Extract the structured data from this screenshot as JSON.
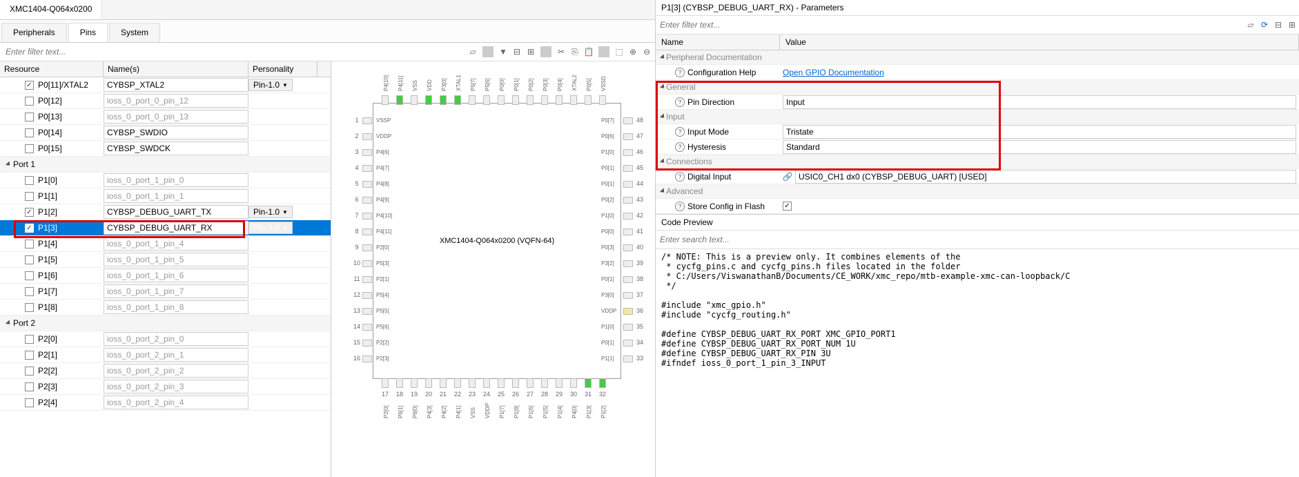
{
  "device_tab": "XMC1404-Q064x0200",
  "sub_tabs": {
    "peripherals": "Peripherals",
    "pins": "Pins",
    "system": "System"
  },
  "filter_placeholder": "Enter filter text...",
  "tree_headers": {
    "resource": "Resource",
    "name": "Name(s)",
    "personality": "Personality"
  },
  "personality_value": "Pin-1.0",
  "ports": [
    {
      "label": "",
      "rows": [
        {
          "res": "P0[11]/XTAL2",
          "checked": true,
          "name": "CYBSP_XTAL2",
          "has_name": true,
          "personality": true
        },
        {
          "res": "P0[12]",
          "checked": false,
          "name": "ioss_0_port_0_pin_12",
          "has_name": false
        },
        {
          "res": "P0[13]",
          "checked": false,
          "name": "ioss_0_port_0_pin_13",
          "has_name": false
        },
        {
          "res": "P0[14]",
          "checked": false,
          "name": "CYBSP_SWDIO",
          "has_name": true
        },
        {
          "res": "P0[15]",
          "checked": false,
          "name": "CYBSP_SWDCK",
          "has_name": true
        }
      ]
    },
    {
      "label": "Port 1",
      "rows": [
        {
          "res": "P1[0]",
          "checked": false,
          "name": "ioss_0_port_1_pin_0",
          "has_name": false
        },
        {
          "res": "P1[1]",
          "checked": false,
          "name": "ioss_0_port_1_pin_1",
          "has_name": false
        },
        {
          "res": "P1[2]",
          "checked": true,
          "name": "CYBSP_DEBUG_UART_TX",
          "has_name": true,
          "personality": true
        },
        {
          "res": "P1[3]",
          "checked": true,
          "name": "CYBSP_DEBUG_UART_RX",
          "has_name": true,
          "personality": true,
          "selected": true
        },
        {
          "res": "P1[4]",
          "checked": false,
          "name": "ioss_0_port_1_pin_4",
          "has_name": false
        },
        {
          "res": "P1[5]",
          "checked": false,
          "name": "ioss_0_port_1_pin_5",
          "has_name": false
        },
        {
          "res": "P1[6]",
          "checked": false,
          "name": "ioss_0_port_1_pin_6",
          "has_name": false
        },
        {
          "res": "P1[7]",
          "checked": false,
          "name": "ioss_0_port_1_pin_7",
          "has_name": false
        },
        {
          "res": "P1[8]",
          "checked": false,
          "name": "ioss_0_port_1_pin_8",
          "has_name": false
        }
      ]
    },
    {
      "label": "Port 2",
      "rows": [
        {
          "res": "P2[0]",
          "checked": false,
          "name": "ioss_0_port_2_pin_0",
          "has_name": false
        },
        {
          "res": "P2[1]",
          "checked": false,
          "name": "ioss_0_port_2_pin_1",
          "has_name": false
        },
        {
          "res": "P2[2]",
          "checked": false,
          "name": "ioss_0_port_2_pin_2",
          "has_name": false
        },
        {
          "res": "P2[3]",
          "checked": false,
          "name": "ioss_0_port_2_pin_3",
          "has_name": false
        },
        {
          "res": "P2[4]",
          "checked": false,
          "name": "ioss_0_port_2_pin_4",
          "has_name": false
        }
      ]
    }
  ],
  "chip_label": "XMC1404-Q064x0200 (VQFN-64)",
  "chip_top_pins": [
    {
      "n": "",
      "name": "P4[10]"
    },
    {
      "n": "",
      "name": "P4[11]",
      "green": true
    },
    {
      "n": "",
      "name": "VSS"
    },
    {
      "n": "",
      "name": "VDD",
      "green": true
    },
    {
      "n": "",
      "name": "P3[0]",
      "green": true
    },
    {
      "n": "",
      "name": "XTAL1",
      "green": true
    },
    {
      "n": "",
      "name": "P5[7]"
    },
    {
      "n": "",
      "name": "P5[6]"
    },
    {
      "n": "",
      "name": "P0[0]"
    },
    {
      "n": "",
      "name": "P0[1]"
    },
    {
      "n": "",
      "name": "P0[2]"
    },
    {
      "n": "",
      "name": "P0[3]"
    },
    {
      "n": "",
      "name": "P0[4]"
    },
    {
      "n": "",
      "name": "XTAL2"
    },
    {
      "n": "",
      "name": "P0[5]"
    },
    {
      "n": "",
      "name": "VSSD"
    }
  ],
  "chip_left_pins": [
    {
      "n": "1",
      "name": "VSSP"
    },
    {
      "n": "2",
      "name": "VDDP"
    },
    {
      "n": "3",
      "name": "P4[6]"
    },
    {
      "n": "4",
      "name": "P4[7]"
    },
    {
      "n": "5",
      "name": "P4[8]"
    },
    {
      "n": "6",
      "name": "P4[9]"
    },
    {
      "n": "7",
      "name": "P4[10]"
    },
    {
      "n": "8",
      "name": "P4[11]"
    },
    {
      "n": "9",
      "name": "P2[0]"
    },
    {
      "n": "10",
      "name": "P5[3]"
    },
    {
      "n": "11",
      "name": "P2[1]"
    },
    {
      "n": "12",
      "name": "P5[4]"
    },
    {
      "n": "13",
      "name": "P5[5]"
    },
    {
      "n": "14",
      "name": "P5[6]"
    },
    {
      "n": "15",
      "name": "P2[2]"
    },
    {
      "n": "16",
      "name": "P2[3]"
    }
  ],
  "chip_right_pins": [
    {
      "n": "48",
      "name": "P0[7]"
    },
    {
      "n": "47",
      "name": "P0[6]"
    },
    {
      "n": "46",
      "name": "P1[0]"
    },
    {
      "n": "45",
      "name": "P0[1]"
    },
    {
      "n": "44",
      "name": "P0[1]"
    },
    {
      "n": "43",
      "name": "P0[2]"
    },
    {
      "n": "42",
      "name": "P1[0]"
    },
    {
      "n": "41",
      "name": "P0[0]"
    },
    {
      "n": "40",
      "name": "P0[3]"
    },
    {
      "n": "39",
      "name": "P3[2]"
    },
    {
      "n": "38",
      "name": "P0[1]"
    },
    {
      "n": "37",
      "name": "P3[0]"
    },
    {
      "n": "36",
      "name": "VDDP",
      "yellow": true
    },
    {
      "n": "35",
      "name": "P1[0]"
    },
    {
      "n": "34",
      "name": "P0[1]"
    },
    {
      "n": "33",
      "name": "P1[1]"
    }
  ],
  "chip_bottom_pins": [
    {
      "n": "17",
      "name": "P2[0]"
    },
    {
      "n": "18",
      "name": "P6[1]"
    },
    {
      "n": "19",
      "name": "P6[0]"
    },
    {
      "n": "20",
      "name": "P4[3]"
    },
    {
      "n": "21",
      "name": "P4[2]"
    },
    {
      "n": "22",
      "name": "P4[1]"
    },
    {
      "n": "23",
      "name": "VSS"
    },
    {
      "n": "24",
      "name": "VDDP"
    },
    {
      "n": "25",
      "name": "P1[7]"
    },
    {
      "n": "26",
      "name": "P1[8]"
    },
    {
      "n": "27",
      "name": "P1[6]"
    },
    {
      "n": "28",
      "name": "P1[5]"
    },
    {
      "n": "29",
      "name": "P1[4]"
    },
    {
      "n": "30",
      "name": "P4[0]"
    },
    {
      "n": "31",
      "name": "P1[3]",
      "green": true
    },
    {
      "n": "32",
      "name": "P1[2]",
      "green": true
    }
  ],
  "params_title": "P1[3] (CYBSP_DEBUG_UART_RX) - Parameters",
  "params_filter": "Enter filter text...",
  "params_headers": {
    "name": "Name",
    "value": "Value"
  },
  "param_groups": {
    "doc": "Peripheral Documentation",
    "general": "General",
    "input": "Input",
    "connections": "Connections",
    "advanced": "Advanced"
  },
  "params": {
    "config_help": {
      "label": "Configuration Help",
      "link": "Open GPIO Documentation"
    },
    "pin_direction": {
      "label": "Pin Direction",
      "value": "Input"
    },
    "input_mode": {
      "label": "Input Mode",
      "value": "Tristate"
    },
    "hysteresis": {
      "label": "Hysteresis",
      "value": "Standard"
    },
    "digital_input": {
      "label": "Digital Input",
      "value": "USIC0_CH1 dx0 (CYBSP_DEBUG_UART) [USED]"
    },
    "store_flash": {
      "label": "Store Config in Flash",
      "checked": true
    }
  },
  "code_preview_title": "Code Preview",
  "code_search": "Enter search text...",
  "code_body": "/* NOTE: This is a preview only. It combines elements of the\n * cycfg_pins.c and cycfg_pins.h files located in the folder\n * C:/Users/ViswanathanB/Documents/CE_WORK/xmc_repo/mtb-example-xmc-can-loopback/C\n */\n\n#include \"xmc_gpio.h\"\n#include \"cycfg_routing.h\"\n\n#define CYBSP_DEBUG_UART_RX_PORT XMC_GPIO_PORT1\n#define CYBSP_DEBUG_UART_RX_PORT_NUM 1U\n#define CYBSP_DEBUG_UART_RX_PIN 3U\n#ifndef ioss_0_port_1_pin_3_INPUT"
}
